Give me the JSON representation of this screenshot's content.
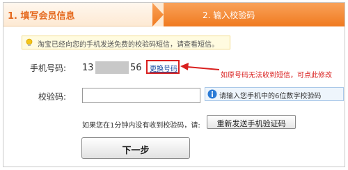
{
  "steps": {
    "step1_label": "1. 填写会员信息",
    "step2_label": "2. 输入校验码"
  },
  "notice": {
    "icon": "lightbulb-icon",
    "text": "淘宝已经向您的手机发送免费的校验码短信，请查看短信。"
  },
  "phone": {
    "label": "手机号码:",
    "prefix": "13",
    "suffix": "56",
    "change_button": "更换号码",
    "hint": "如原号码无法收到短信，可点此修改"
  },
  "code": {
    "label": "校验码:",
    "value": "",
    "info_icon": "info-icon",
    "info_text": "请输入您手机中的6位数字校验码"
  },
  "resend": {
    "text": "如果您在1分钟内没有收到校验码，请:",
    "button": "重新发送手机验证码"
  },
  "next_button": "下一步",
  "colors": {
    "step_active": "#f07a1f",
    "step_inactive_text": "#e56a1f",
    "annotation_red": "#d9201f",
    "link_blue": "#1d4fa3"
  }
}
